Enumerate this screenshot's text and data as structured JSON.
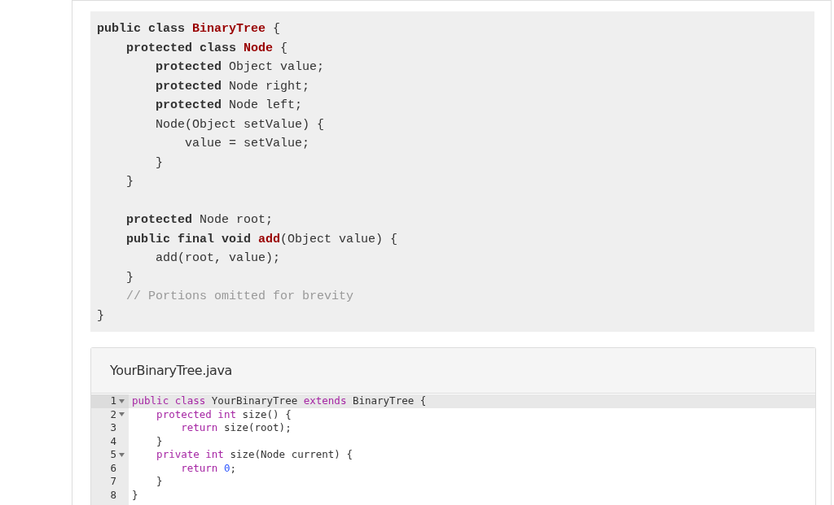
{
  "code_block": {
    "lines": [
      {
        "kind": "code",
        "tokens": [
          {
            "t": "public class ",
            "kind": "kw"
          },
          {
            "t": "BinaryTree",
            "kind": "name"
          },
          {
            "t": " {",
            "kind": "plain"
          }
        ]
      },
      {
        "kind": "code",
        "tokens": [
          {
            "t": "    protected class ",
            "kind": "kw"
          },
          {
            "t": "Node",
            "kind": "name"
          },
          {
            "t": " {",
            "kind": "plain"
          }
        ]
      },
      {
        "kind": "code",
        "tokens": [
          {
            "t": "        protected",
            "kind": "kw"
          },
          {
            "t": " Object value;",
            "kind": "plain"
          }
        ]
      },
      {
        "kind": "code",
        "tokens": [
          {
            "t": "        protected",
            "kind": "kw"
          },
          {
            "t": " Node right;",
            "kind": "plain"
          }
        ]
      },
      {
        "kind": "code",
        "tokens": [
          {
            "t": "        protected",
            "kind": "kw"
          },
          {
            "t": " Node left;",
            "kind": "plain"
          }
        ]
      },
      {
        "kind": "code",
        "tokens": [
          {
            "t": "        Node(Object setValue) {",
            "kind": "plain"
          }
        ]
      },
      {
        "kind": "code",
        "tokens": [
          {
            "t": "            value = setValue;",
            "kind": "plain"
          }
        ]
      },
      {
        "kind": "code",
        "tokens": [
          {
            "t": "        }",
            "kind": "plain"
          }
        ]
      },
      {
        "kind": "code",
        "tokens": [
          {
            "t": "    }",
            "kind": "plain"
          }
        ]
      },
      {
        "kind": "blank"
      },
      {
        "kind": "code",
        "tokens": [
          {
            "t": "    protected",
            "kind": "kw"
          },
          {
            "t": " Node root;",
            "kind": "plain"
          }
        ]
      },
      {
        "kind": "code",
        "tokens": [
          {
            "t": "    public final void ",
            "kind": "kw"
          },
          {
            "t": "add",
            "kind": "name"
          },
          {
            "t": "(Object value) {",
            "kind": "plain"
          }
        ]
      },
      {
        "kind": "code",
        "tokens": [
          {
            "t": "        add(root, value);",
            "kind": "plain"
          }
        ]
      },
      {
        "kind": "code",
        "tokens": [
          {
            "t": "    }",
            "kind": "plain"
          }
        ]
      },
      {
        "kind": "code",
        "tokens": [
          {
            "t": "    // Portions omitted for brevity",
            "kind": "comment"
          }
        ]
      },
      {
        "kind": "code",
        "tokens": [
          {
            "t": "}",
            "kind": "plain"
          }
        ]
      }
    ]
  },
  "editor": {
    "filename": "YourBinaryTree.java",
    "lines": [
      {
        "number": "1",
        "foldable": true,
        "selected": true,
        "tokens": [
          {
            "t": "public class",
            "kind": "kw"
          },
          {
            "t": " YourBinaryTree ",
            "kind": "plain"
          },
          {
            "t": "extends",
            "kind": "kw"
          },
          {
            "t": " BinaryTree {",
            "kind": "plain"
          }
        ]
      },
      {
        "number": "2",
        "foldable": true,
        "selected": false,
        "tokens": [
          {
            "t": "    protected int",
            "kind": "kw"
          },
          {
            "t": " size() {",
            "kind": "plain"
          }
        ]
      },
      {
        "number": "3",
        "foldable": false,
        "selected": false,
        "tokens": [
          {
            "t": "        return",
            "kind": "kw"
          },
          {
            "t": " size(root);",
            "kind": "plain"
          }
        ]
      },
      {
        "number": "4",
        "foldable": false,
        "selected": false,
        "tokens": [
          {
            "t": "    }",
            "kind": "plain"
          }
        ]
      },
      {
        "number": "5",
        "foldable": true,
        "selected": false,
        "tokens": [
          {
            "t": "    private int",
            "kind": "kw"
          },
          {
            "t": " size(Node current) {",
            "kind": "plain"
          }
        ]
      },
      {
        "number": "6",
        "foldable": false,
        "selected": false,
        "tokens": [
          {
            "t": "        return ",
            "kind": "kw"
          },
          {
            "t": "0",
            "kind": "num"
          },
          {
            "t": ";",
            "kind": "plain"
          }
        ]
      },
      {
        "number": "7",
        "foldable": false,
        "selected": false,
        "tokens": [
          {
            "t": "    }",
            "kind": "plain"
          }
        ]
      },
      {
        "number": "8",
        "foldable": false,
        "selected": false,
        "tokens": [
          {
            "t": "}",
            "kind": "plain"
          }
        ]
      }
    ]
  }
}
